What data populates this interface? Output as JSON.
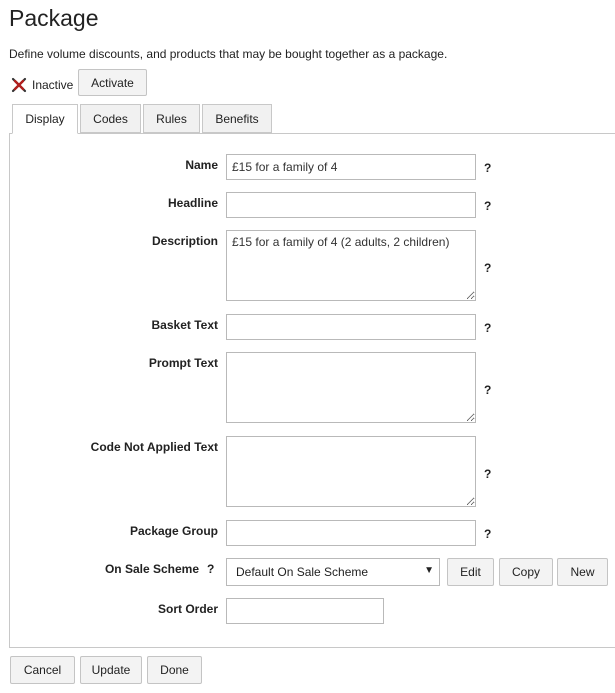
{
  "page": {
    "title": "Package",
    "subtitle": "Define volume discounts, and products that may be bought together as a package."
  },
  "status": {
    "label": "Inactive",
    "icon": "inactive-cross-icon",
    "color": "#b1201e",
    "activate_label": "Activate"
  },
  "tabs": [
    {
      "label": "Display",
      "active": true
    },
    {
      "label": "Codes",
      "active": false
    },
    {
      "label": "Rules",
      "active": false
    },
    {
      "label": "Benefits",
      "active": false
    }
  ],
  "form": {
    "help_symbol": "?",
    "name": {
      "label": "Name",
      "value": "£15 for a family of 4"
    },
    "headline": {
      "label": "Headline",
      "value": ""
    },
    "description": {
      "label": "Description",
      "value": "£15 for a family of 4 (2 adults, 2 children)"
    },
    "basket_text": {
      "label": "Basket Text",
      "value": ""
    },
    "prompt_text": {
      "label": "Prompt Text",
      "value": ""
    },
    "code_not_applied_text": {
      "label": "Code Not Applied Text",
      "value": ""
    },
    "package_group": {
      "label": "Package Group",
      "value": ""
    },
    "on_sale_scheme": {
      "label": "On Sale Scheme",
      "selected": "Default On Sale Scheme",
      "arrow": "▼",
      "edit_label": "Edit",
      "copy_label": "Copy",
      "new_label": "New"
    },
    "sort_order": {
      "label": "Sort Order",
      "value": ""
    }
  },
  "footer": {
    "cancel_label": "Cancel",
    "update_label": "Update",
    "done_label": "Done"
  }
}
